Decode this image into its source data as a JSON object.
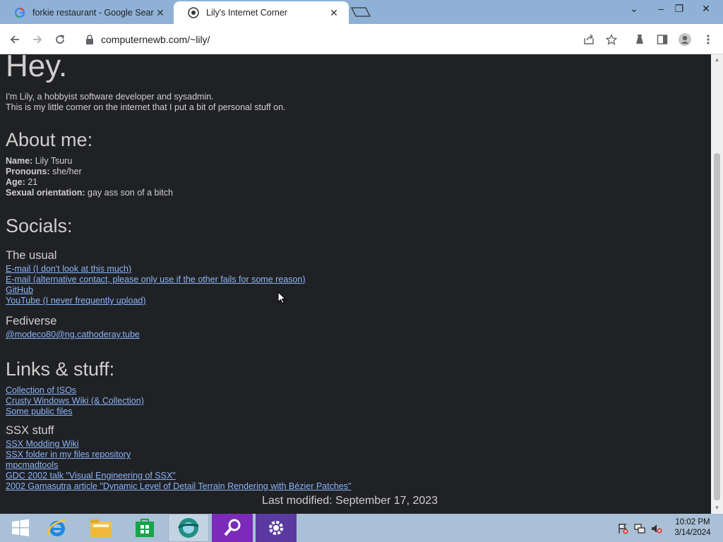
{
  "browser": {
    "tabs": [
      {
        "title": "forkie restaurant - Google Search",
        "favicon": "google-g-icon"
      },
      {
        "title": "Lily's Internet Corner",
        "favicon": "site-favicon-icon"
      }
    ],
    "address": "computernewb.com/~lily/"
  },
  "page": {
    "heading": "Hey.",
    "intro_line1": "I'm Lily, a hobbyist software developer and sysadmin.",
    "intro_line2": "This is my little corner on the internet that I put a bit of personal stuff on.",
    "about_heading": "About me:",
    "about": {
      "name_label": "Name:",
      "name_value": "Lily Tsuru",
      "pronouns_label": "Pronouns:",
      "pronouns_value": "she/her",
      "age_label": "Age:",
      "age_value": "21",
      "orientation_label": "Sexual orientation:",
      "orientation_value": "gay ass son of a bitch"
    },
    "socials_heading": "Socials:",
    "usual_heading": "The usual",
    "usual_links": [
      "E-mail (I don't look at this much)",
      "E-mail (alternative contact, please only use if the other fails for some reason)",
      "GitHub",
      "YouTube (I never frequently upload)"
    ],
    "fediverse_heading": "Fediverse",
    "fediverse_link": "@modeco80@ng.cathoderay.tube",
    "links_heading": "Links & stuff:",
    "links": [
      "Collection of ISOs",
      "Crusty Windows Wiki (& Collection)",
      "Some public files"
    ],
    "ssx_heading": "SSX stuff",
    "ssx_links": [
      "SSX Modding Wiki",
      "SSX folder in my files repository",
      "mpcmadtools",
      "GDC 2002 talk \"Visual Engineering of SSX\"",
      "2002 Gamasutra article \"Dynamic Level of Detail Terrain Rendering with Bézier Patches\""
    ],
    "last_modified": "Last modified: September 17, 2023"
  },
  "taskbar": {
    "apps": [
      "start-icon",
      "internet-explorer-icon",
      "file-explorer-icon",
      "store-icon",
      "browser-icon",
      "search-icon",
      "settings-icon"
    ],
    "time": "10:02 PM",
    "date": "3/14/2024"
  },
  "colors": {
    "page_bg": "#202124",
    "link": "#8ab4f8",
    "text": "#cfcfcf",
    "tabbar": "#8fb1d6",
    "taskbar": "#a9c0d6"
  }
}
